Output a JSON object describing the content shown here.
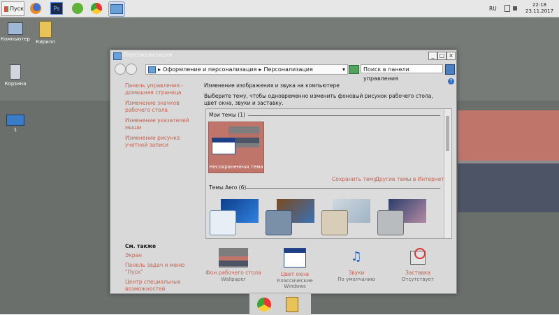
{
  "taskbar": {
    "start_label": "Пуск",
    "language": "RU",
    "time": "22:18",
    "date": "23.11.2017"
  },
  "desktop_icons": [
    {
      "label": "Компьютер"
    },
    {
      "label": "Кирилл"
    },
    {
      "label": "Корзина"
    },
    {
      "label": "1"
    }
  ],
  "window": {
    "title": "Персонализация",
    "min_label": "_",
    "max_label": "□",
    "close_label": "×",
    "breadcrumb": [
      "Оформление и персонализация",
      "Персонализация"
    ],
    "search_placeholder": "Поиск в панели управления",
    "left_links": [
      "Панель управления - домашняя страница",
      "Изменение значков рабочего стола",
      "Изменение указателей мыши",
      "Изменение рисунка учетной записи"
    ],
    "see_also_title": "См. также",
    "see_also": [
      "Экран",
      "Панель задач и меню \"Пуск\"",
      "Центр специальных возможностей"
    ],
    "heading": "Изменение изображения и звука на компьютере",
    "description": "Выберите тему, чтобы одновременно изменить фоновый рисунок рабочего стола, цвет окна, звуки и заставку.",
    "my_themes_label": "Мои темы (1)",
    "unsaved_theme": "Несохраненная тема",
    "save_theme": "Сохранить тему",
    "online_themes": "Другие темы в Интернете",
    "aero_label": "Темы Aero (6)",
    "bottom_items": [
      {
        "label": "Фон рабочего стола",
        "sub": "Wallpaper"
      },
      {
        "label": "Цвет окна",
        "sub": "Классические Windows"
      },
      {
        "label": "Звуки",
        "sub": "По умолчанию"
      },
      {
        "label": "Заставка",
        "sub": "Отсутствует"
      }
    ]
  },
  "colors": {
    "link": "#c8624f",
    "selected_theme": "#c0756b"
  }
}
